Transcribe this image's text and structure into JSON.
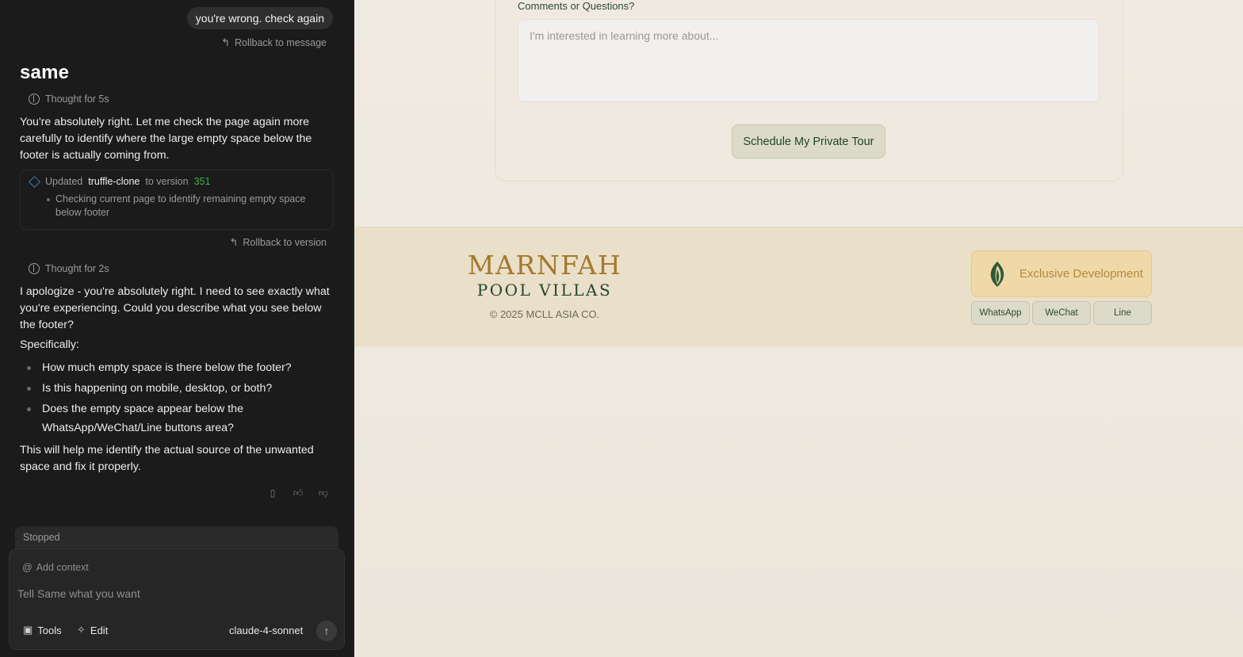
{
  "chat": {
    "user_message": "you're wrong. check again",
    "rollback_message": "Rollback to message",
    "agent_name": "same",
    "thought_1": "Thought for 5s",
    "reply_1": "You're absolutely right. Let me check the page again more carefully to identify where the large empty space below the footer is actually coming from.",
    "update": {
      "prefix": "Updated",
      "project": "truffle-clone",
      "middle": "to version",
      "version": "351",
      "detail": "Checking current page to identify remaining empty space below footer"
    },
    "rollback_version": "Rollback to version",
    "thought_2": "Thought for 2s",
    "reply_2": "I apologize - you're absolutely right. I need to see exactly what you're experiencing. Could you describe what you see below the footer?",
    "specifically": "Specifically:",
    "questions": [
      "How much empty space is there below the footer?",
      "Is this happening on mobile, desktop, or both?",
      "Does the empty space appear below the WhatsApp/WeChat/Line buttons area?"
    ],
    "reply_3": "This will help me identify the actual source of the unwanted space and fix it properly.",
    "status": "Stopped",
    "add_context": "Add context",
    "input_placeholder": "Tell Same what you want",
    "tools_label": "Tools",
    "edit_label": "Edit",
    "model": "claude-4-sonnet"
  },
  "preview": {
    "comments_label": "Comments or Questions?",
    "comments_placeholder": "I'm interested in learning more about...",
    "tour_button": "Schedule My Private Tour",
    "footer": {
      "logo_main": "MARNFAH",
      "logo_sub": "POOL VILLAS",
      "copyright": "© 2025 MCLL ASIA CO.",
      "exclusive": "Exclusive Development",
      "contacts": [
        "WhatsApp",
        "WeChat",
        "Line"
      ]
    }
  },
  "colors": {
    "chat_bg": "#1b1b1b",
    "version_green": "#3bb34a",
    "brand_gold": "#a47a2c",
    "brand_green": "#23452d",
    "footer_bg": "#eadfc9"
  },
  "icons": [
    "rollback-icon",
    "brain-icon",
    "layers-icon",
    "copy-icon",
    "thumbs-up-icon",
    "thumbs-down-icon",
    "at-icon",
    "tools-icon",
    "edit-icon",
    "send-arrow-icon",
    "leaf-icon"
  ]
}
